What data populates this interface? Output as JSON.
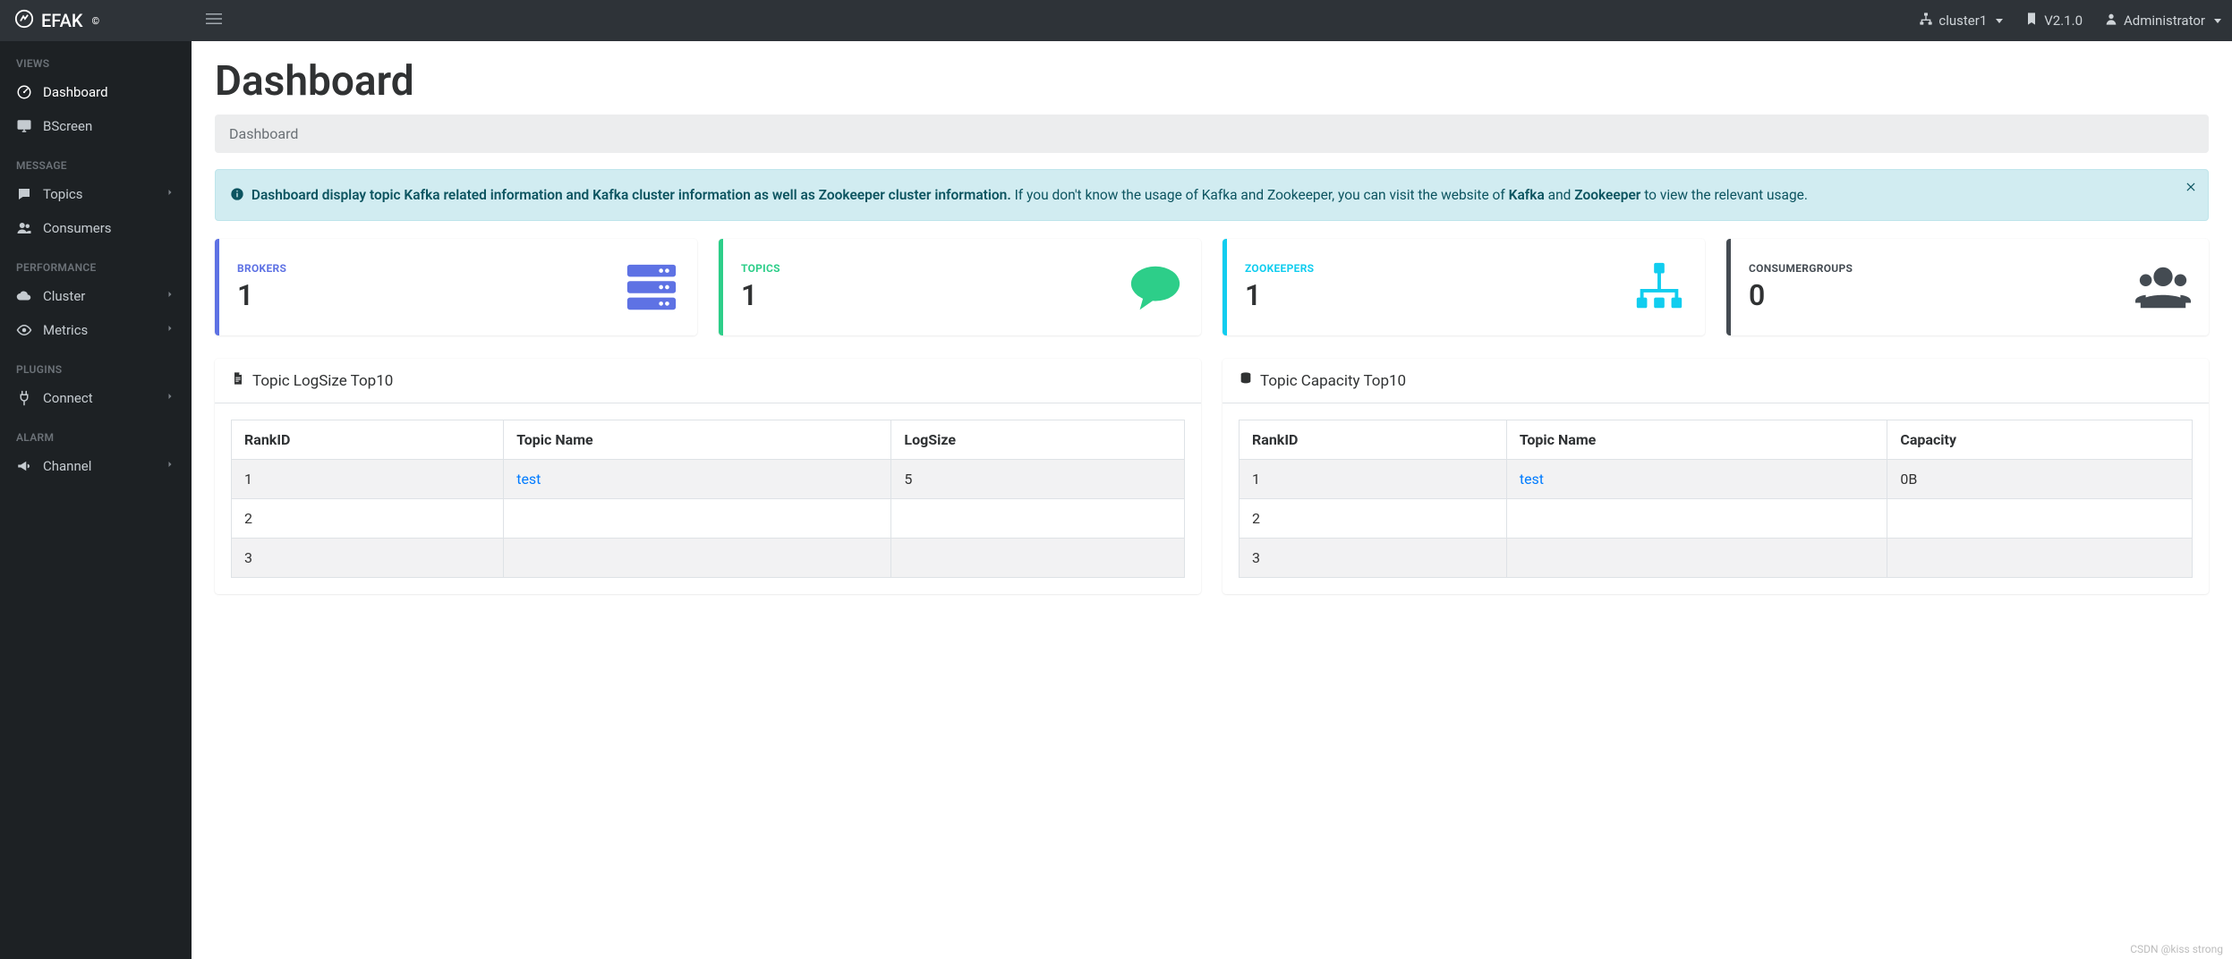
{
  "brand": {
    "name": "EFAK",
    "copyright": "©"
  },
  "topbar": {
    "cluster": "cluster1",
    "version": "V2.1.0",
    "user": "Administrator"
  },
  "sidebar": {
    "sections": [
      {
        "title": "VIEWS",
        "items": [
          {
            "icon": "dashboard",
            "label": "Dashboard",
            "active": true,
            "expandable": false
          },
          {
            "icon": "monitor",
            "label": "BScreen",
            "active": false,
            "expandable": false
          }
        ]
      },
      {
        "title": "MESSAGE",
        "items": [
          {
            "icon": "comment",
            "label": "Topics",
            "active": false,
            "expandable": true
          },
          {
            "icon": "users",
            "label": "Consumers",
            "active": false,
            "expandable": false
          }
        ]
      },
      {
        "title": "PERFORMANCE",
        "items": [
          {
            "icon": "cloud",
            "label": "Cluster",
            "active": false,
            "expandable": true
          },
          {
            "icon": "eye",
            "label": "Metrics",
            "active": false,
            "expandable": true
          }
        ]
      },
      {
        "title": "PLUGINS",
        "items": [
          {
            "icon": "plug",
            "label": "Connect",
            "active": false,
            "expandable": true
          }
        ]
      },
      {
        "title": "ALARM",
        "items": [
          {
            "icon": "bullhorn",
            "label": "Channel",
            "active": false,
            "expandable": true
          }
        ]
      }
    ]
  },
  "page": {
    "title": "Dashboard",
    "breadcrumb": "Dashboard"
  },
  "alert": {
    "lead": "Dashboard display topic Kafka related information and Kafka cluster information as well as Zookeeper cluster information.",
    "tail_pre": " If you don't know the usage of Kafka and Zookeeper, you can visit the website of ",
    "kafka": "Kafka",
    "and": " and ",
    "zk": "Zookeeper",
    "tail_post": " to view the relevant usage."
  },
  "cards": {
    "brokers": {
      "label": "BROKERS",
      "value": "1"
    },
    "topics": {
      "label": "TOPICS",
      "value": "1"
    },
    "zookeepers": {
      "label": "ZOOKEEPERS",
      "value": "1"
    },
    "consumergroups": {
      "label": "CONSUMERGROUPS",
      "value": "0"
    }
  },
  "panels": {
    "logsize": {
      "title": "Topic LogSize Top10",
      "headers": [
        "RankID",
        "Topic Name",
        "LogSize"
      ]
    },
    "capacity": {
      "title": "Topic Capacity Top10",
      "headers": [
        "RankID",
        "Topic Name",
        "Capacity"
      ]
    }
  },
  "tables": {
    "logsize_rows": [
      {
        "rank": "1",
        "topic": "test",
        "value": "5"
      },
      {
        "rank": "2",
        "topic": "",
        "value": ""
      },
      {
        "rank": "3",
        "topic": "",
        "value": ""
      }
    ],
    "capacity_rows": [
      {
        "rank": "1",
        "topic": "test",
        "value": "0B"
      },
      {
        "rank": "2",
        "topic": "",
        "value": ""
      },
      {
        "rank": "3",
        "topic": "",
        "value": ""
      }
    ]
  },
  "watermark": "CSDN @kiss strong"
}
